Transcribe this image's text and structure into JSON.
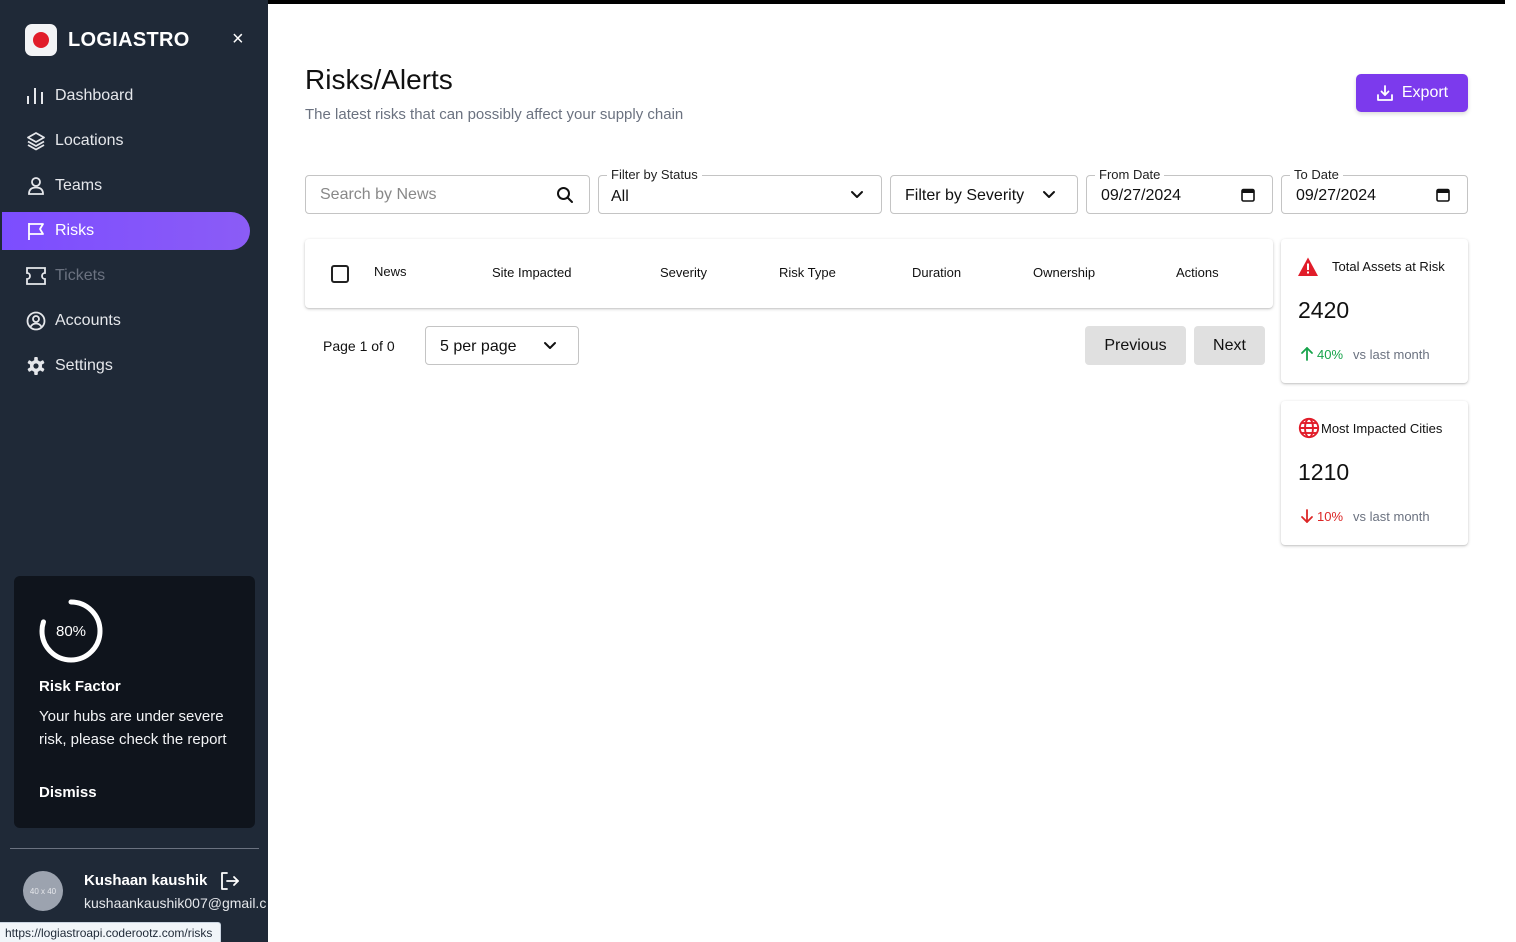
{
  "brand": {
    "name": "LOGIASTRO",
    "close_glyph": "×"
  },
  "nav": {
    "items": [
      {
        "label": "Dashboard",
        "icon": "bar-chart-icon"
      },
      {
        "label": "Locations",
        "icon": "layers-icon"
      },
      {
        "label": "Teams",
        "icon": "user-icon"
      },
      {
        "label": "Risks",
        "icon": "flag-icon",
        "active": true
      },
      {
        "label": "Tickets",
        "icon": "ticket-icon",
        "disabled": true
      },
      {
        "label": "Accounts",
        "icon": "account-circle-icon"
      },
      {
        "label": "Settings",
        "icon": "gear-icon"
      }
    ]
  },
  "risk_card": {
    "percent_text": "80%",
    "percent": 80,
    "title": "Risk Factor",
    "text": "Your hubs are under severe risk, please check the report",
    "dismiss": "Dismiss"
  },
  "user": {
    "avatar_text": "40 x 40",
    "name": "Kushaan kaushik",
    "email": "kushaankaushik007@gmail.c"
  },
  "status_url": "https://logiastroapi.coderootz.com/risks",
  "page": {
    "title": "Risks/Alerts",
    "subtitle": "The latest risks that can possibly affect your supply chain",
    "export_label": "Export"
  },
  "filters": {
    "search_placeholder": "Search by News",
    "status_legend": "Filter by Status",
    "status_value": "All",
    "severity_label": "Filter by Severity",
    "from_legend": "From Date",
    "from_value": "09/27/2024",
    "to_legend": "To Date",
    "to_value": "09/27/2024"
  },
  "table": {
    "headers": [
      "News",
      "Site Impacted",
      "Severity",
      "Risk Type",
      "Duration",
      "Ownership",
      "Actions"
    ]
  },
  "pagination": {
    "page_info": "Page 1 of 0",
    "per_page": "5 per page",
    "previous": "Previous",
    "next": "Next"
  },
  "stats": [
    {
      "title": "Total Assets at Risk",
      "value": "2420",
      "change": "40%",
      "direction": "up",
      "note": "vs last month",
      "color": "#16a34a",
      "icon": "warning-icon"
    },
    {
      "title": "Most Impacted Cities",
      "value": "1210",
      "change": "10%",
      "direction": "down",
      "note": "vs last month",
      "color": "#dc2626",
      "icon": "globe-icon"
    }
  ],
  "colors": {
    "sidebar": "#1f2937",
    "accent": "#7c3aed",
    "danger": "#e11d2a"
  }
}
